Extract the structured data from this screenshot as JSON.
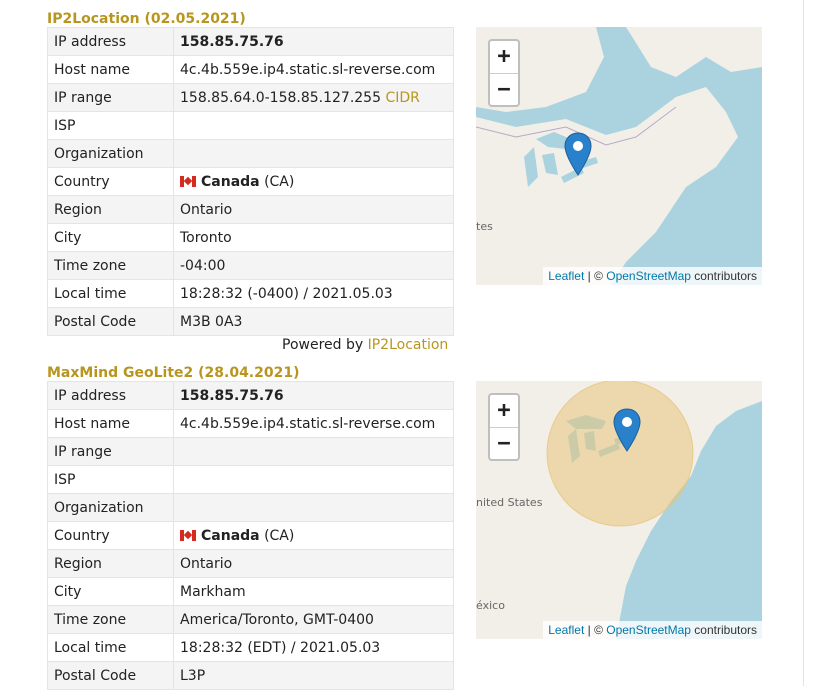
{
  "sections": [
    {
      "title": "IP2Location (02.05.2021)",
      "rows": [
        {
          "key": "IP address",
          "value": "158.85.75.76"
        },
        {
          "key": "Host name",
          "value": "4c.4b.559e.ip4.static.sl-reverse.com"
        },
        {
          "key": "IP range",
          "value": "158.85.64.0-158.85.127.255",
          "link": "CIDR"
        },
        {
          "key": "ISP",
          "value": ""
        },
        {
          "key": "Organization",
          "value": ""
        },
        {
          "key": "Country",
          "value": "Canada",
          "suffix": "(CA)"
        },
        {
          "key": "Region",
          "value": "Ontario"
        },
        {
          "key": "City",
          "value": "Toronto"
        },
        {
          "key": "Time zone",
          "value": "-04:00"
        },
        {
          "key": "Local time",
          "value": "18:28:32 (-0400) / 2021.05.03"
        },
        {
          "key": "Postal Code",
          "value": "M3B 0A3"
        }
      ],
      "powered_prefix": "Powered by",
      "powered_link": "IP2Location",
      "map": {
        "label": "tes"
      }
    },
    {
      "title": "MaxMind GeoLite2 (28.04.2021)",
      "rows": [
        {
          "key": "IP address",
          "value": "158.85.75.76"
        },
        {
          "key": "Host name",
          "value": "4c.4b.559e.ip4.static.sl-reverse.com"
        },
        {
          "key": "IP range",
          "value": ""
        },
        {
          "key": "ISP",
          "value": ""
        },
        {
          "key": "Organization",
          "value": ""
        },
        {
          "key": "Country",
          "value": "Canada",
          "suffix": "(CA)"
        },
        {
          "key": "Region",
          "value": "Ontario"
        },
        {
          "key": "City",
          "value": "Markham"
        },
        {
          "key": "Time zone",
          "value": "America/Toronto, GMT-0400"
        },
        {
          "key": "Local time",
          "value": "18:28:32 (EDT) / 2021.05.03"
        },
        {
          "key": "Postal Code",
          "value": "L3P"
        }
      ],
      "map": {
        "label": "nited States",
        "label2": "éxico"
      }
    }
  ],
  "map_common": {
    "zoom_in": "+",
    "zoom_out": "−",
    "leaflet": "Leaflet",
    "separator": " | © ",
    "osm": "OpenStreetMap",
    "contributors": " contributors"
  },
  "colors": {
    "accent": "#b8961e",
    "water": "#aad3df",
    "land": "#f2efe9",
    "pin": "#2a81cb",
    "accuracy_circle": "#e8c47a",
    "link": "#0078a8"
  }
}
